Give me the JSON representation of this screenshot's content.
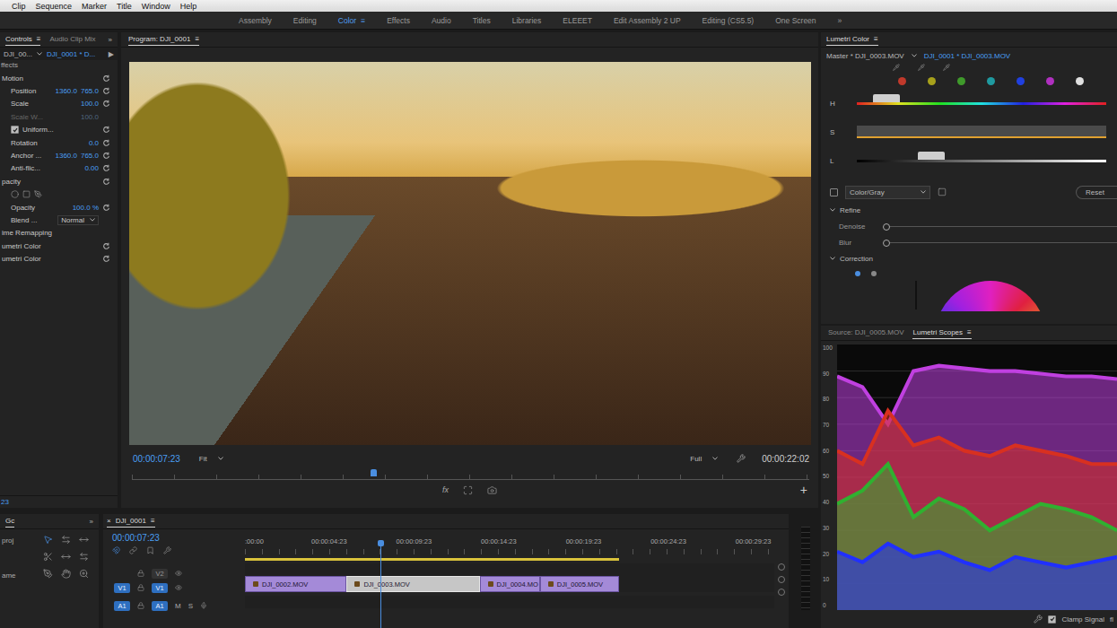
{
  "menu_bar": {
    "items": [
      "Clip",
      "Sequence",
      "Marker",
      "Title",
      "Window",
      "Help"
    ]
  },
  "workspaces": {
    "items": [
      {
        "label": "Assembly",
        "selected": false
      },
      {
        "label": "Editing",
        "selected": false
      },
      {
        "label": "Color",
        "selected": true
      },
      {
        "label": "Effects",
        "selected": false
      },
      {
        "label": "Audio",
        "selected": false
      },
      {
        "label": "Titles",
        "selected": false
      },
      {
        "label": "Libraries",
        "selected": false
      },
      {
        "label": "ELEEET",
        "selected": false
      },
      {
        "label": "Edit Assembly 2 UP",
        "selected": false
      },
      {
        "label": "Editing (CS5.5)",
        "selected": false
      },
      {
        "label": "One Screen",
        "selected": false
      }
    ],
    "menu_glyph": "≡",
    "more": "»"
  },
  "effect_controls": {
    "tabs": [
      {
        "label": "Controls",
        "selected": true
      },
      {
        "label": "Audio Clip Mix",
        "selected": false
      }
    ],
    "menu_glyph": "≡",
    "more": "»",
    "source": "DJI_00...",
    "clip": "DJI_0001 * D...",
    "play": "▶",
    "section": "ffects",
    "rows": [
      {
        "kind": "group",
        "label": "Motion",
        "reset": true
      },
      {
        "kind": "param",
        "label": "Position",
        "values": [
          "1360.0",
          "765.0"
        ],
        "disabled": false,
        "reset": true
      },
      {
        "kind": "param",
        "label": "Scale",
        "values": [
          "100.0"
        ],
        "disabled": false,
        "reset": true
      },
      {
        "kind": "param",
        "label": "Scale W...",
        "values": [
          "100.0"
        ],
        "disabled": true,
        "reset": false
      },
      {
        "kind": "check",
        "label": "Uniform...",
        "checked": true,
        "reset": true
      },
      {
        "kind": "param",
        "label": "Rotation",
        "values": [
          "0.0"
        ],
        "disabled": false,
        "reset": true
      },
      {
        "kind": "param",
        "label": "Anchor ...",
        "values": [
          "1360.0",
          "765.0"
        ],
        "disabled": false,
        "reset": true
      },
      {
        "kind": "param",
        "label": "Anti-flic...",
        "values": [
          "0.00"
        ],
        "disabled": false,
        "reset": true
      },
      {
        "kind": "group",
        "label": "pacity",
        "reset": true
      },
      {
        "kind": "masks",
        "reset": false
      },
      {
        "kind": "param",
        "label": "Opacity",
        "values": [
          "100.0 %"
        ],
        "disabled": false,
        "reset": true
      },
      {
        "kind": "select",
        "label": "Blend ...",
        "value": "Normal",
        "reset": false
      },
      {
        "kind": "group",
        "label": "ime Remapping",
        "reset": false
      },
      {
        "kind": "group",
        "label": "umetri Color",
        "reset": true
      },
      {
        "kind": "group",
        "label": "umetri Color",
        "reset": true
      }
    ],
    "timecode": "23"
  },
  "program": {
    "title": "Program: DJI_0001",
    "menu_glyph": "≡",
    "timecode": "00:00:07:23",
    "zoom": "Fit",
    "quality": "Full",
    "duration": "00:00:22:02",
    "playhead": {
      "level": 0.356
    },
    "fx": "fx",
    "add": "+"
  },
  "tools": {
    "title": "Gc",
    "more": "»",
    "items": [
      "proj",
      "ame"
    ]
  },
  "timeline": {
    "close": "×",
    "title": "DJI_0001",
    "menu_glyph": "≡",
    "timecode": "00:00:07:23",
    "visible_seconds": 31.2,
    "playhead_seconds": 7.98,
    "work_area": {
      "start": 0,
      "end": 22.07
    },
    "ticks": [
      {
        "label": ":00:00",
        "time": 0
      },
      {
        "label": "00:00:04:23",
        "time": 4.96
      },
      {
        "label": "00:00:09:23",
        "time": 9.96
      },
      {
        "label": "00:00:14:23",
        "time": 14.96
      },
      {
        "label": "00:00:19:23",
        "time": 19.96
      },
      {
        "label": "00:00:24:23",
        "time": 24.96
      },
      {
        "label": "00:00:29:23",
        "time": 29.96
      }
    ],
    "tracks": [
      {
        "label": "V2",
        "kind": "video",
        "targeted": false
      },
      {
        "label": "V1",
        "kind": "video",
        "targeted": true
      },
      {
        "label": "A1",
        "kind": "audio",
        "targeted": true,
        "mute": "M",
        "solo": "S"
      }
    ],
    "clips": [
      {
        "label": "DJI_0002.MOV",
        "track": "V1",
        "start": 0,
        "end": 6.0,
        "selected": false
      },
      {
        "label": "DJI_0003.MOV",
        "track": "V1",
        "start": 6.0,
        "end": 13.83,
        "selected": true
      },
      {
        "label": "DJI_0004.MO",
        "track": "V1",
        "start": 13.83,
        "end": 17.39,
        "selected": false
      },
      {
        "label": "DJI_0005.MOV",
        "track": "V1",
        "start": 17.39,
        "end": 22.07,
        "selected": false
      }
    ]
  },
  "lumetri": {
    "title": "Lumetri Color",
    "menu_glyph": "≡",
    "master": "Master * DJI_0003.MOV",
    "clip": "DJI_0001 * DJI_0003.MOV",
    "swatches": [
      {
        "color": "#c0392b"
      },
      {
        "color": "#a7a11b"
      },
      {
        "color": "#3f9a2b"
      },
      {
        "color": "#1f9aa0"
      },
      {
        "color": "#2040e0"
      },
      {
        "color": "#b030c0"
      },
      {
        "color": "#e0e0e0"
      }
    ],
    "sliders": [
      {
        "label": "H",
        "kind": "hue",
        "level": 0.12
      },
      {
        "label": "S",
        "kind": "saturation"
      },
      {
        "label": "L",
        "kind": "luma",
        "level": 0.3
      }
    ],
    "color_gray": {
      "label": "Color/Gray",
      "checked": false
    },
    "reset": "Reset",
    "refine": {
      "label": "Refine",
      "expanded": true,
      "sliders": [
        {
          "label": "Denoise",
          "level": 0
        },
        {
          "label": "Blur",
          "level": 0
        }
      ]
    },
    "correction": {
      "label": "Correction",
      "expanded": true,
      "modes": [
        {
          "selected": true
        },
        {
          "selected": false
        }
      ]
    }
  },
  "scopes": {
    "tabs": [
      {
        "label": "Source: DJI_0005.MOV",
        "selected": false
      },
      {
        "label": "Lumetri Scopes",
        "selected": true
      }
    ],
    "menu_glyph": "≡",
    "ticks": [
      "100",
      "90",
      "80",
      "70",
      "60",
      "50",
      "40",
      "30",
      "20",
      "10",
      "0"
    ],
    "traces": [
      {
        "name": "magenta",
        "color": "#c040e0",
        "values": [
          88,
          84,
          70,
          90,
          92,
          91,
          90,
          90,
          89,
          88,
          88,
          87
        ]
      },
      {
        "name": "red",
        "color": "#d83020",
        "values": [
          60,
          55,
          75,
          62,
          65,
          60,
          58,
          62,
          60,
          58,
          55,
          55
        ]
      },
      {
        "name": "green",
        "color": "#30b030",
        "values": [
          40,
          45,
          55,
          35,
          42,
          38,
          30,
          35,
          40,
          38,
          35,
          30
        ]
      },
      {
        "name": "blue",
        "color": "#2030ff",
        "values": [
          22,
          18,
          25,
          20,
          22,
          18,
          15,
          20,
          18,
          16,
          18,
          20
        ]
      }
    ],
    "clamp": {
      "label": "Clamp Signal",
      "checked": true
    },
    "cut_label": "fl"
  }
}
